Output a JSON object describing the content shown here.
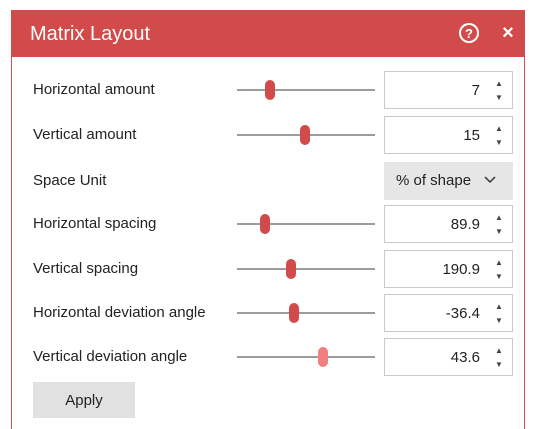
{
  "window": {
    "title": "Matrix Layout",
    "help_glyph": "?",
    "close_glyph": "×",
    "accent": "#d24b4b"
  },
  "rows": [
    {
      "label": "Horizontal amount",
      "value": "7",
      "slider_fraction": 0.24
    },
    {
      "label": "Vertical amount",
      "value": "15",
      "slider_fraction": 0.49
    },
    {
      "label": "Space Unit",
      "selected": "% of shape"
    },
    {
      "label": "Horizontal spacing",
      "value": "89.9",
      "slider_fraction": 0.2
    },
    {
      "label": "Vertical spacing",
      "value": "190.9",
      "slider_fraction": 0.39
    },
    {
      "label": "Horizontal deviation angle",
      "value": "-36.4",
      "slider_fraction": 0.41
    },
    {
      "label": "Vertical deviation angle",
      "value": "43.6",
      "slider_fraction": 0.62
    }
  ],
  "apply_label": "Apply",
  "icons": {
    "help": "help-circle-icon",
    "close": "close-icon",
    "spin_up": "triangle-up-icon",
    "spin_down": "triangle-down-icon",
    "dropdown": "chevron-down-icon"
  }
}
